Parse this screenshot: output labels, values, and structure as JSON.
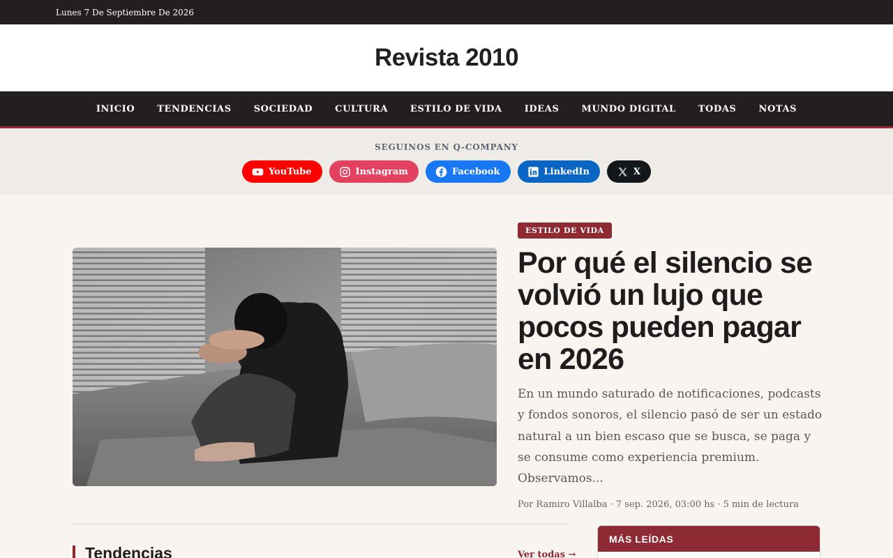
{
  "topbar": {
    "date": "Lunes 7 De Septiembre De 2026"
  },
  "masthead": {
    "brand": "Revista 2010"
  },
  "nav": {
    "items": [
      "INICIO",
      "TENDENCIAS",
      "SOCIEDAD",
      "CULTURA",
      "ESTILO DE VIDA",
      "IDEAS",
      "MUNDO DIGITAL",
      "TODAS",
      "NOTAS"
    ]
  },
  "social": {
    "label": "SEGUINOS EN Q-COMPANY",
    "links": [
      {
        "label": "YouTube",
        "icon": "youtube-icon",
        "color": "#ff0000"
      },
      {
        "label": "Instagram",
        "icon": "instagram-icon",
        "color": "#e4405f"
      },
      {
        "label": "Facebook",
        "icon": "facebook-icon",
        "color": "#1877f2"
      },
      {
        "label": "LinkedIn",
        "icon": "linkedin-icon",
        "color": "#0a66c2"
      },
      {
        "label": "X",
        "icon": "x-icon",
        "color": "#14171a"
      }
    ]
  },
  "featured": {
    "category": "ESTILO DE VIDA",
    "title": "Por qué el silencio se volvió un lujo que pocos pueden pagar en 2026",
    "excerpt": "En un mundo saturado de notificaciones, podcasts y fondos sonoros, el silencio pasó de ser un estado natural a un bien escaso que se busca, se paga y se consume como experiencia premium. Observamos...",
    "meta": "Por Ramiro Villalba · 7 sep. 2026, 03:00 hs · 5 min de lectura"
  },
  "sections": {
    "tendencias_title": "Tendencias",
    "see_all": "Ver todas →"
  },
  "sidebar": {
    "mas_leidas_title": "MÁS LEÍDAS"
  },
  "colors": {
    "accent": "#8e2a33",
    "dark": "#231f20",
    "background": "#f8f5f1"
  }
}
